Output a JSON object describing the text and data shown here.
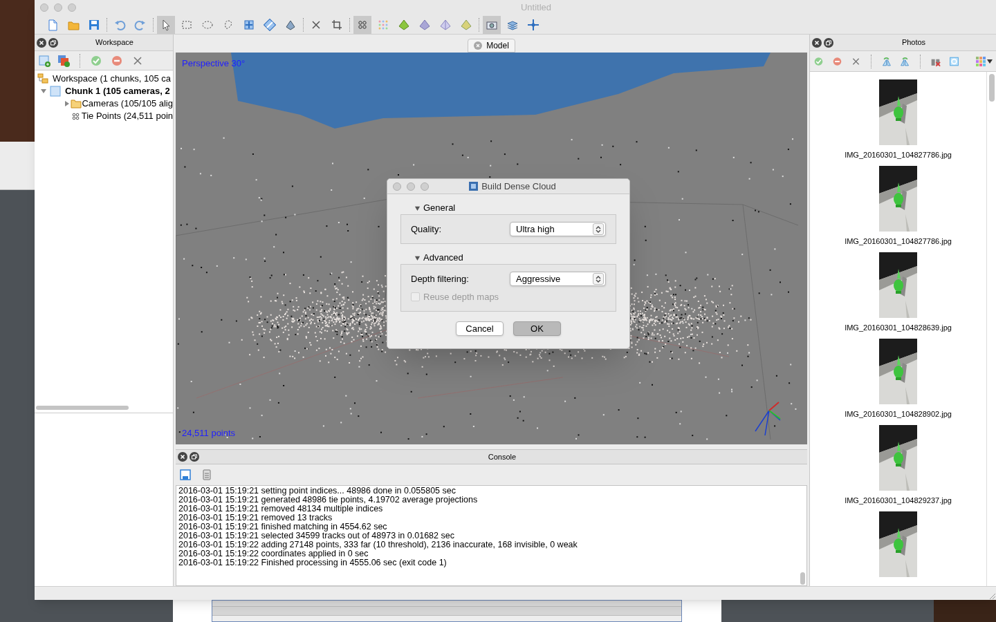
{
  "window": {
    "title": "Untitled"
  },
  "toolbar": [
    [
      {
        "kind": "new",
        "selected": false
      },
      {
        "kind": "open",
        "selected": false
      },
      {
        "kind": "save",
        "selected": false
      }
    ],
    [
      {
        "kind": "undo",
        "selected": false
      },
      {
        "kind": "redo",
        "selected": false
      }
    ],
    [
      {
        "kind": "pointer",
        "selected": true
      },
      {
        "kind": "rect",
        "selected": false
      },
      {
        "kind": "ellipse",
        "selected": false
      },
      {
        "kind": "lasso",
        "selected": false
      },
      {
        "kind": "move",
        "selected": false
      },
      {
        "kind": "rotate",
        "selected": false
      },
      {
        "kind": "resize",
        "selected": false
      }
    ],
    [
      {
        "kind": "delete",
        "selected": false
      },
      {
        "kind": "crop",
        "selected": false
      }
    ],
    [
      {
        "kind": "points",
        "selected": true
      },
      {
        "kind": "dense",
        "selected": false
      },
      {
        "kind": "mesh",
        "selected": false
      },
      {
        "kind": "solid",
        "selected": false
      },
      {
        "kind": "wire",
        "selected": false
      },
      {
        "kind": "texture",
        "selected": false
      }
    ],
    [
      {
        "kind": "camera",
        "selected": true
      },
      {
        "kind": "layers",
        "selected": false
      },
      {
        "kind": "navigate",
        "selected": false
      }
    ]
  ],
  "workspace": {
    "title": "Workspace",
    "tree": [
      {
        "label": "Workspace (1 chunks, 105 ca",
        "kind": "workspace",
        "bold": false,
        "children": [
          {
            "label": "Chunk 1 (105 cameras, 2",
            "kind": "chunk",
            "bold": true,
            "expanded": true,
            "children": [
              {
                "label": "Cameras (105/105 alig",
                "kind": "folder",
                "bold": false,
                "expanded": false
              },
              {
                "label": "Tie Points (24,511 poin",
                "kind": "points",
                "bold": false
              }
            ]
          }
        ]
      }
    ]
  },
  "model": {
    "tab": "Model",
    "projection": "Perspective 30°",
    "point_count": "24,511 points"
  },
  "dialog": {
    "title": "Build Dense Cloud",
    "sections": [
      {
        "title": "General",
        "expanded": true,
        "fields": [
          {
            "kind": "select",
            "label": "Quality:",
            "value": "Ultra high"
          }
        ]
      },
      {
        "title": "Advanced",
        "expanded": true,
        "fields": [
          {
            "kind": "select",
            "label": "Depth filtering:",
            "value": "Aggressive"
          },
          {
            "kind": "checkbox",
            "label": "Reuse depth maps",
            "checked": false,
            "disabled": true
          }
        ]
      }
    ],
    "buttons": [
      {
        "label": "Cancel",
        "default": false
      },
      {
        "label": "OK",
        "default": true
      }
    ]
  },
  "console": {
    "title": "Console",
    "lines": [
      "2016-03-01 15:19:21 setting point indices... 48986 done in 0.055805 sec",
      "2016-03-01 15:19:21 generated 48986 tie points, 4.19702 average projections",
      "2016-03-01 15:19:21 removed 48134 multiple indices",
      "2016-03-01 15:19:21 removed 13 tracks",
      "2016-03-01 15:19:21 finished matching in 4554.62 sec",
      "2016-03-01 15:19:21 selected 34599 tracks out of 48973 in 0.01682 sec",
      "2016-03-01 15:19:22 adding 27148 points, 333 far (10 threshold), 2136 inaccurate, 168 invisible, 0 weak",
      "2016-03-01 15:19:22 coordinates applied in 0 sec",
      "2016-03-01 15:19:22 Finished processing in 4555.06 sec (exit code 1)"
    ]
  },
  "photos": {
    "title": "Photos",
    "items": [
      {
        "label": "IMG_20160301_104827786.jpg"
      },
      {
        "label": "IMG_20160301_104827786.jpg"
      },
      {
        "label": "IMG_20160301_104828639.jpg"
      },
      {
        "label": "IMG_20160301_104828902.jpg"
      },
      {
        "label": "IMG_20160301_104829237.jpg"
      },
      {
        "kind": "picture"
      }
    ]
  }
}
